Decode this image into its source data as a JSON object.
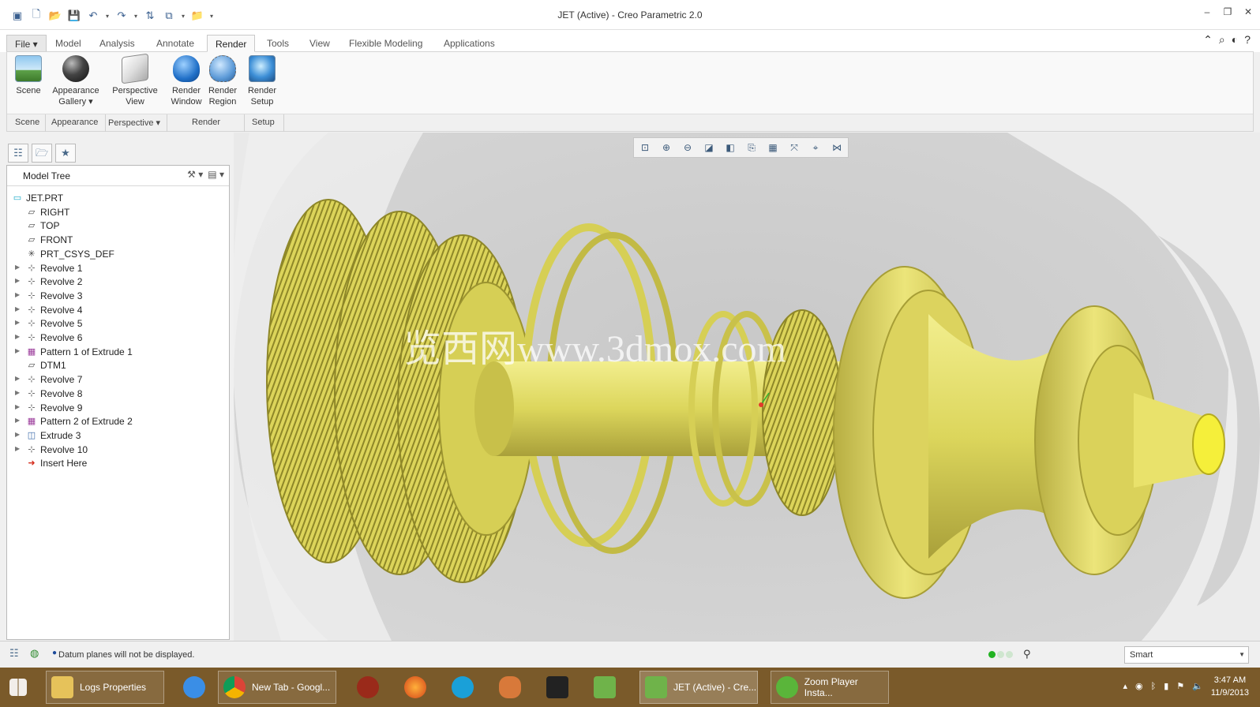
{
  "window": {
    "title": "JET (Active) - Creo Parametric 2.0"
  },
  "quick_access": [
    "new-icon",
    "open-icon",
    "save-icon",
    "undo-icon",
    "redo-icon",
    "regenerate-icon",
    "windows-icon",
    "close-window-icon",
    "customize-icon"
  ],
  "tabs": [
    {
      "label": "File"
    },
    {
      "label": "Model"
    },
    {
      "label": "Analysis"
    },
    {
      "label": "Annotate"
    },
    {
      "label": "Render"
    },
    {
      "label": "Tools"
    },
    {
      "label": "View"
    },
    {
      "label": "Flexible Modeling"
    },
    {
      "label": "Applications"
    }
  ],
  "ribbon": {
    "buttons": [
      {
        "label1": "Scene",
        "label2": ""
      },
      {
        "label1": "Appearance",
        "label2": "Gallery"
      },
      {
        "label1": "Perspective",
        "label2": "View"
      },
      {
        "label1": "Render",
        "label2": "Window"
      },
      {
        "label1": "Render",
        "label2": "Region"
      },
      {
        "label1": "Render",
        "label2": "Setup"
      }
    ],
    "groups": [
      "Scene",
      "Appearance",
      "Perspective",
      "Render",
      "Setup"
    ]
  },
  "model_tree": {
    "title": "Model Tree",
    "items": [
      {
        "label": "JET.PRT",
        "icon": "part-icon"
      },
      {
        "label": "RIGHT",
        "icon": "datum-plane-icon"
      },
      {
        "label": "TOP",
        "icon": "datum-plane-icon"
      },
      {
        "label": "FRONT",
        "icon": "datum-plane-icon"
      },
      {
        "label": "PRT_CSYS_DEF",
        "icon": "csys-icon"
      },
      {
        "label": "Revolve 1",
        "icon": "revolve-icon"
      },
      {
        "label": "Revolve 2",
        "icon": "revolve-icon"
      },
      {
        "label": "Revolve 3",
        "icon": "revolve-icon"
      },
      {
        "label": "Revolve 4",
        "icon": "revolve-icon"
      },
      {
        "label": "Revolve 5",
        "icon": "revolve-icon"
      },
      {
        "label": "Revolve 6",
        "icon": "revolve-icon"
      },
      {
        "label": "Pattern 1 of Extrude 1",
        "icon": "pattern-icon"
      },
      {
        "label": "DTM1",
        "icon": "datum-plane-icon"
      },
      {
        "label": "Revolve 7",
        "icon": "revolve-icon"
      },
      {
        "label": "Revolve 8",
        "icon": "revolve-icon"
      },
      {
        "label": "Revolve 9",
        "icon": "revolve-icon"
      },
      {
        "label": "Pattern 2 of Extrude 2",
        "icon": "pattern-icon"
      },
      {
        "label": "Extrude 3",
        "icon": "extrude-icon"
      },
      {
        "label": "Revolve 10",
        "icon": "revolve-icon"
      },
      {
        "label": "Insert Here",
        "icon": "insert-arrow-icon"
      }
    ]
  },
  "viewport": {
    "watermark": "览西网www.3dmox.com",
    "model_color": "#e6e06a"
  },
  "status": {
    "message": "Datum planes will not be displayed.",
    "filter": "Smart"
  },
  "taskbar": {
    "items": [
      {
        "label": "Logs Properties"
      },
      {
        "label": "New Tab - Googl..."
      },
      {
        "label": "JET (Active) - Cre..."
      },
      {
        "label": "Zoom Player Insta..."
      }
    ],
    "time": "3:47 AM",
    "date": "11/9/2013"
  }
}
